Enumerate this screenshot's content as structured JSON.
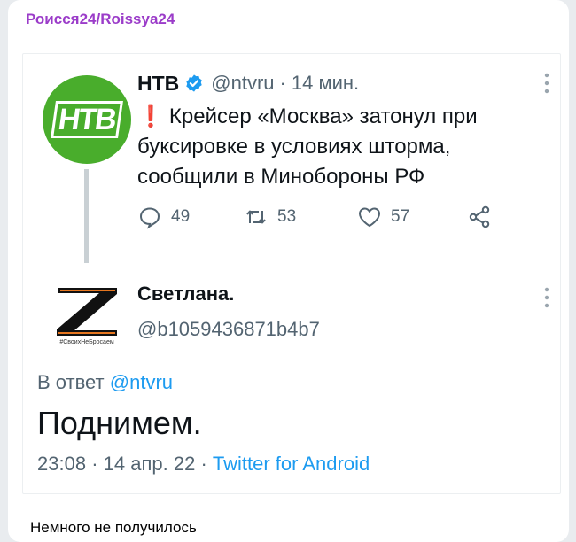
{
  "channel": {
    "name": "Роисся24/Roissya24"
  },
  "tweet1": {
    "name": "НТВ",
    "handle": "@ntvru",
    "separator": "·",
    "time": "14 мин.",
    "alert_mark": "❗",
    "text": "Крейсер «Москва» затонул при буксировке в условиях шторма, сообщили в Минобороны РФ",
    "avatar_logo": "НТВ",
    "replies": "49",
    "retweets": "53",
    "likes": "57"
  },
  "tweet2": {
    "name": "Светлана.",
    "handle": "@b1059436871b4b7",
    "avatar_caption": "#СвоихНеБросаем",
    "reply_prefix": "В ответ",
    "reply_mention": "@ntvru",
    "text": "Поднимем.",
    "time": "23:08",
    "sep1": "·",
    "date": "14 апр. 22",
    "sep2": "·",
    "source": "Twitter for Android"
  },
  "message": {
    "caption": "Немного не получилось"
  },
  "icons": {
    "verified": "verified-badge-icon",
    "more": "more-vertical-icon",
    "reply": "reply-icon",
    "retweet": "retweet-icon",
    "like": "heart-icon",
    "share": "share-icon"
  },
  "colors": {
    "channel_name": "#9b3cc9",
    "ntv_green": "#49ad2c",
    "twitter_blue": "#1d9bf0",
    "secondary_text": "#536471",
    "alert_red": "#e0245e"
  }
}
